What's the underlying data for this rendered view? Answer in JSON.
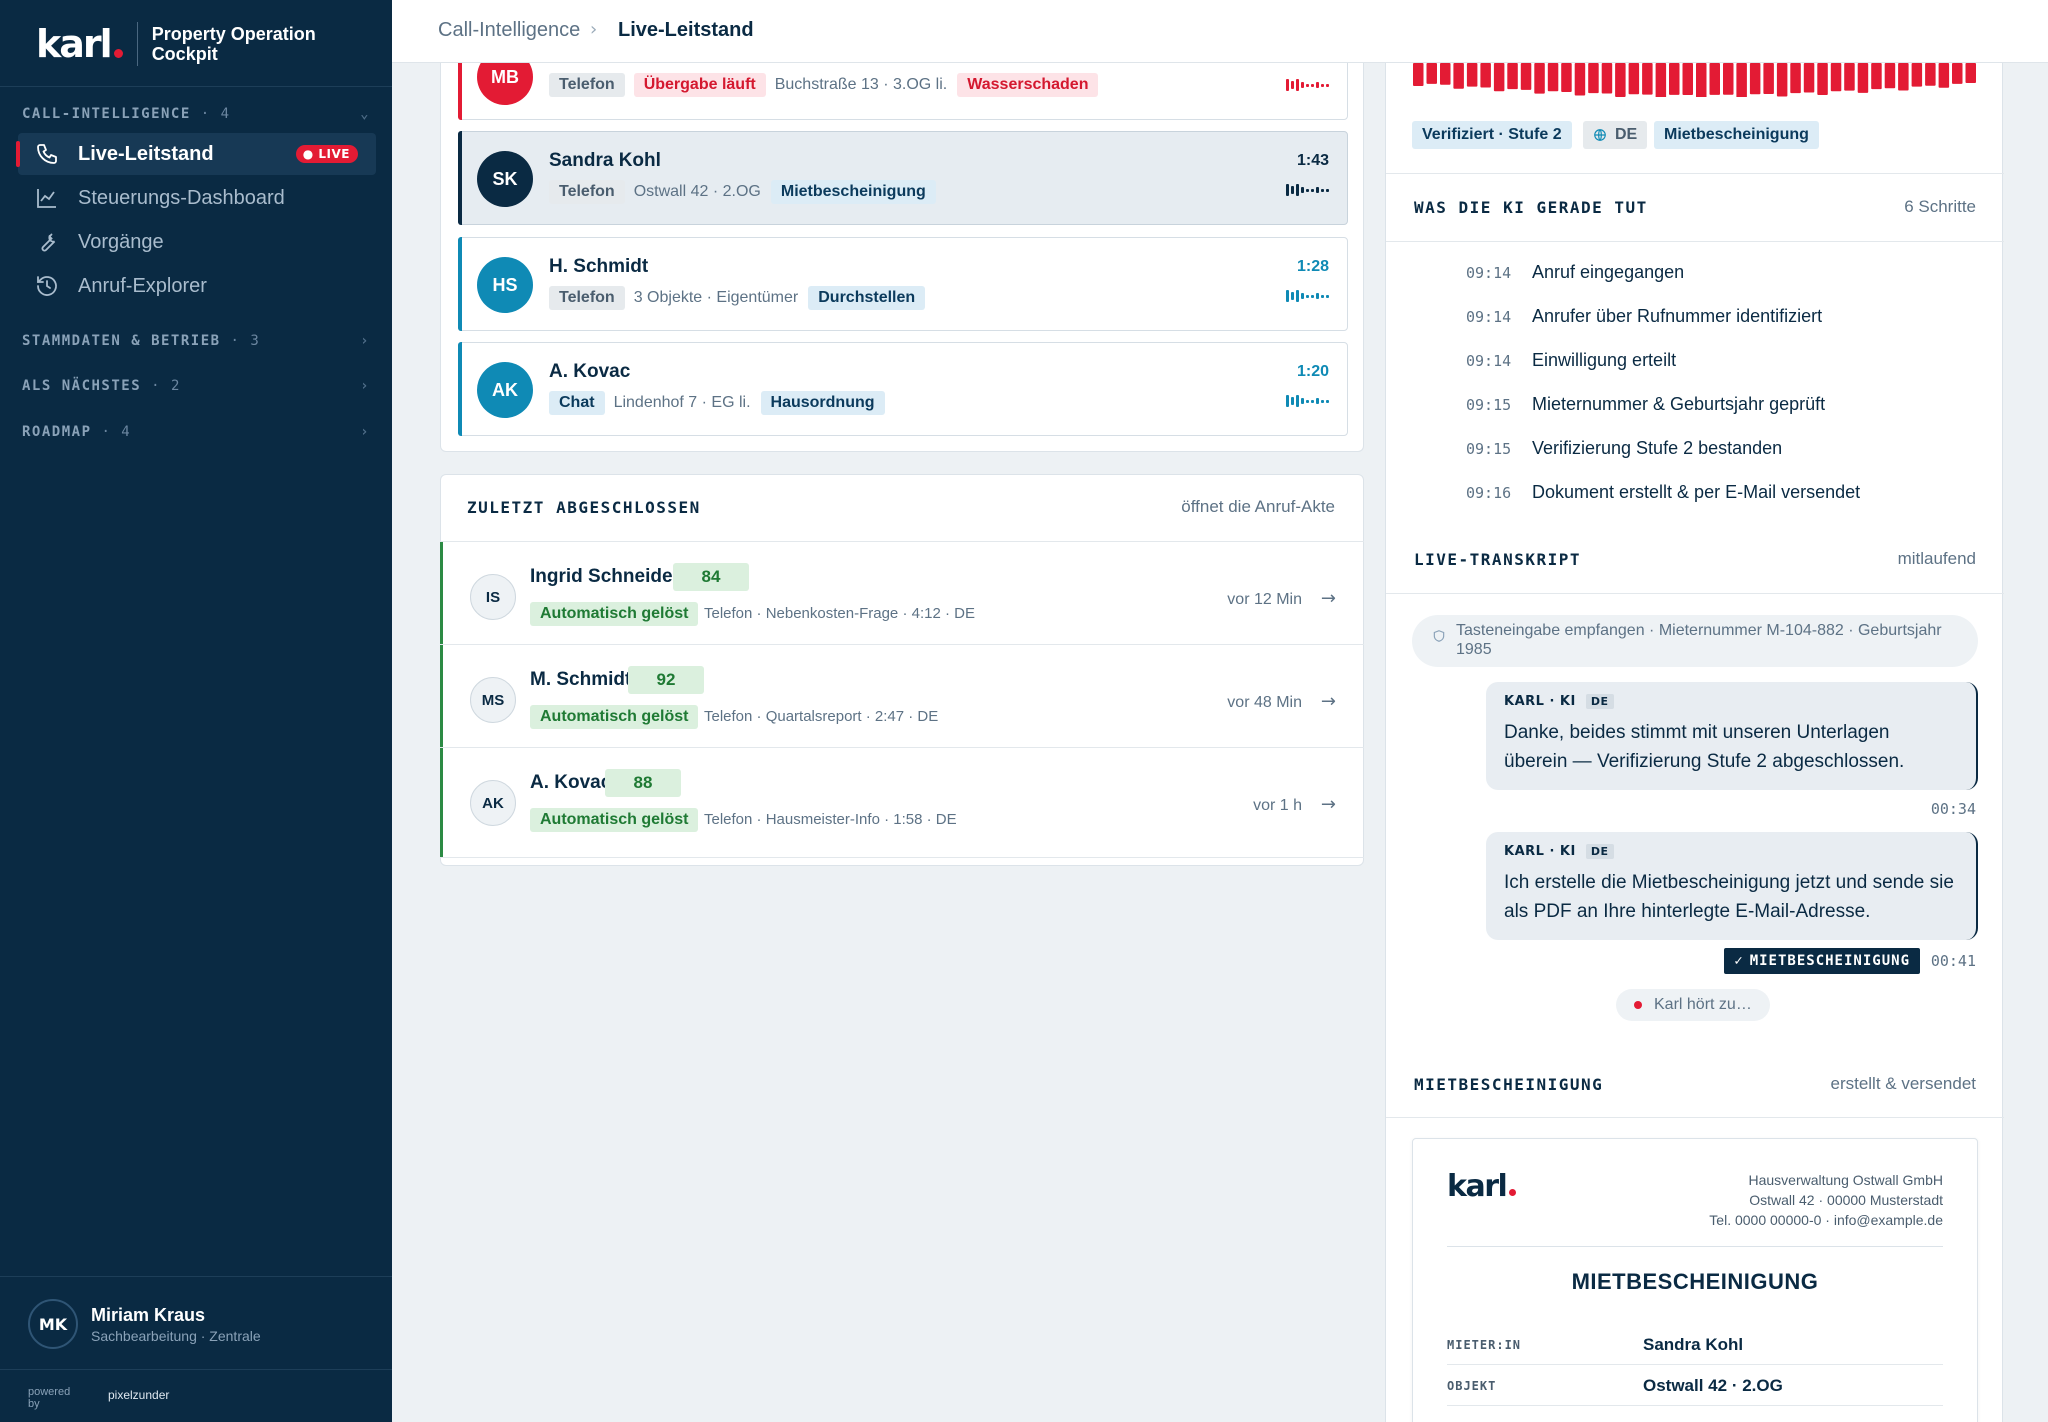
{
  "brand": {
    "logo": "karl",
    "subtitle_1": "Property Operation",
    "subtitle_2": "Cockpit"
  },
  "sidebar": {
    "sections": [
      {
        "title": "CALL-INTELLIGENCE",
        "count": "· 4"
      },
      {
        "title": "STAMMDATEN & BETRIEB",
        "count": "· 3"
      },
      {
        "title": "ALS NÄCHSTES",
        "count": "· 2"
      },
      {
        "title": "ROADMAP",
        "count": "· 4"
      }
    ],
    "items": [
      {
        "label": "Live-Leitstand",
        "icon": "phone-icon",
        "badge": "LIVE"
      },
      {
        "label": "Steuerungs-Dashboard",
        "icon": "chart-line-icon"
      },
      {
        "label": "Vorgänge",
        "icon": "wrench-icon"
      },
      {
        "label": "Anruf-Explorer",
        "icon": "history-icon"
      }
    ],
    "user": {
      "initials": "MK",
      "name": "Miriam Kraus",
      "role": "Sachbearbeitung · Zentrale"
    },
    "powered_by": {
      "label": "powered by",
      "brand": "pixelzunder"
    }
  },
  "topbar": {
    "breadcrumb_parent": "Call-Intelligence",
    "breadcrumb_current": "Live-Leitstand"
  },
  "active_calls": [
    {
      "initials": "MB",
      "channel": "Telefon",
      "status": "Übergabe läuft",
      "address": "Buchstraße 13 · 3.OG li.",
      "topic": "Wasserschaden",
      "color": "#e31b34"
    },
    {
      "initials": "SK",
      "name": "Sandra Kohl",
      "channel": "Telefon",
      "address": "Ostwall 42 · 2.OG",
      "topic": "Mietbescheinigung",
      "time": "1:43",
      "color": "#0a2a43"
    },
    {
      "initials": "HS",
      "name": "H. Schmidt",
      "channel": "Telefon",
      "address": "3 Objekte · Eigentümer",
      "topic": "Durchstellen",
      "time": "1:28",
      "color": "#0f8ab5"
    },
    {
      "initials": "AK",
      "name": "A. Kovac",
      "channel": "Chat",
      "address": "Lindenhof 7 · EG li.",
      "topic": "Hausordnung",
      "time": "1:20",
      "color": "#0f8ab5"
    }
  ],
  "recent": {
    "title": "ZULETZT ABGESCHLOSSEN",
    "hint": "öffnet die Anruf-Akte",
    "rows": [
      {
        "initials": "IS",
        "name": "Ingrid Schneider",
        "score": "84",
        "status": "Automatisch gelöst",
        "info": "Telefon · Nebenkosten-Frage · 4:12 · DE",
        "ago": "vor 12 Min"
      },
      {
        "initials": "MS",
        "name": "M. Schmidt",
        "score": "92",
        "status": "Automatisch gelöst",
        "info": "Telefon · Quartalsreport · 2:47 · DE",
        "ago": "vor 48 Min"
      },
      {
        "initials": "AK",
        "name": "A. Kovac",
        "score": "88",
        "status": "Automatisch gelöst",
        "info": "Telefon · Hausmeister-Info · 1:58 · DE",
        "ago": "vor 1 h"
      }
    ]
  },
  "detail": {
    "tags": {
      "verified": "Verifiziert · Stufe 2",
      "lang": "DE",
      "topic": "Mietbescheinigung"
    },
    "ai": {
      "title": "WAS DIE KI GERADE TUT",
      "count": "6 Schritte",
      "steps": [
        {
          "time": "09:14",
          "label": "Anruf eingegangen"
        },
        {
          "time": "09:14",
          "label": "Anrufer über Rufnummer identifiziert"
        },
        {
          "time": "09:14",
          "label": "Einwilligung erteilt"
        },
        {
          "time": "09:15",
          "label": "Mieternummer & Geburtsjahr geprüft"
        },
        {
          "time": "09:15",
          "label": "Verifizierung Stufe 2 bestanden"
        },
        {
          "time": "09:16",
          "label": "Dokument erstellt & per E-Mail versendet"
        }
      ]
    },
    "transcript": {
      "title": "LIVE-TRANSKRIPT",
      "mode": "mitlaufend",
      "system": "Tasteneingabe empfangen · Mieternummer M-104-882 · Geburtsjahr 1985",
      "messages": [
        {
          "speaker": "KARL · KI",
          "lang": "DE",
          "text": "Danke, beides stimmt mit unseren Unterlagen überein — Verifizierung Stufe 2 abgeschlossen.",
          "time": "00:34"
        },
        {
          "speaker": "KARL · KI",
          "lang": "DE",
          "text": "Ich erstelle die Mietbescheinigung jetzt und sende sie als PDF an Ihre hinterlegte E-Mail-Adresse.",
          "time": "00:41",
          "chip": "MIETBESCHEINIGUNG"
        }
      ],
      "listening": "Karl hört zu…"
    },
    "document": {
      "section_title": "MIETBESCHEINIGUNG",
      "section_status": "erstellt & versendet",
      "logo": "karl",
      "address_1": "Hausverwaltung Ostwall GmbH",
      "address_2": "Ostwall 42 · 00000 Musterstadt",
      "address_3": "Tel. 0000 00000-0 · info@example.de",
      "title": "MIETBESCHEINIGUNG",
      "fields": [
        {
          "key": "MIETER:IN",
          "value": "Sandra Kohl"
        },
        {
          "key": "OBJEKT",
          "value": "Ostwall 42 · 2.OG"
        }
      ]
    }
  },
  "colors": {
    "navy": "#0a2a43",
    "red": "#e31b34",
    "teal": "#0f8ab5",
    "green": "#1f7a34"
  }
}
